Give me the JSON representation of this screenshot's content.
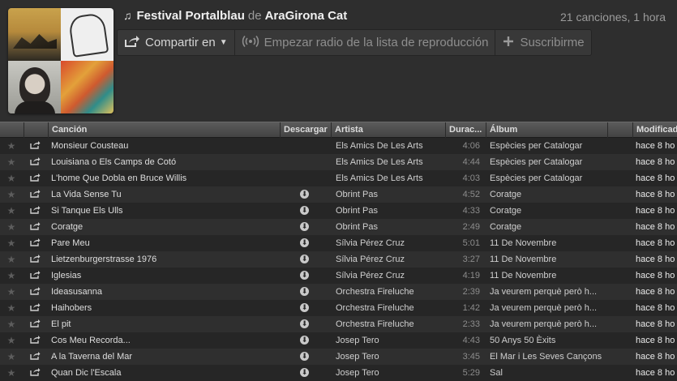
{
  "header": {
    "note_icon": "♫",
    "playlist_name": "Festival Portalblau",
    "by_label": "de",
    "owner": "AraGirona Cat",
    "summary": "21 canciones, 1 hora"
  },
  "toolbar": {
    "share_label": "Compartir en",
    "radio_label": "Empezar radio de la lista de reproducción",
    "subscribe_label": "Suscribirme"
  },
  "columns": {
    "song": "Canción",
    "download": "Descargar",
    "artist": "Artista",
    "duration": "Durac...",
    "album": "Álbum",
    "modified": "Modificad"
  },
  "icons": {
    "star": "★",
    "share": "↗",
    "download": "⬇"
  },
  "tracks": [
    {
      "song": "Monsieur Cousteau",
      "downloadable": false,
      "artist": "Els Amics De Les Arts",
      "duration": "4:06",
      "album": "Espècies per Catalogar",
      "modified": "hace 8 ho"
    },
    {
      "song": "Louisiana o Els Camps de Cotó",
      "downloadable": false,
      "artist": "Els Amics De Les Arts",
      "duration": "4:44",
      "album": "Espècies per Catalogar",
      "modified": "hace 8 ho"
    },
    {
      "song": "L'home Que Dobla en Bruce Willis",
      "downloadable": false,
      "artist": "Els Amics De Les Arts",
      "duration": "4:03",
      "album": "Espècies per Catalogar",
      "modified": "hace 8 ho"
    },
    {
      "song": "La Vida Sense Tu",
      "downloadable": true,
      "artist": "Obrint Pas",
      "duration": "4:52",
      "album": "Coratge",
      "modified": "hace 8 ho"
    },
    {
      "song": "Si Tanque Els Ulls",
      "downloadable": true,
      "artist": "Obrint Pas",
      "duration": "4:33",
      "album": "Coratge",
      "modified": "hace 8 ho"
    },
    {
      "song": "Coratge",
      "downloadable": true,
      "artist": "Obrint Pas",
      "duration": "2:49",
      "album": "Coratge",
      "modified": "hace 8 ho"
    },
    {
      "song": "Pare Meu",
      "downloadable": true,
      "artist": "Sílvia Pérez Cruz",
      "duration": "5:01",
      "album": "11 De Novembre",
      "modified": "hace 8 ho"
    },
    {
      "song": "Lietzenburgerstrasse 1976",
      "downloadable": true,
      "artist": "Sílvia Pérez Cruz",
      "duration": "3:27",
      "album": "11 De Novembre",
      "modified": "hace 8 ho"
    },
    {
      "song": "Iglesias",
      "downloadable": true,
      "artist": "Sílvia Pérez Cruz",
      "duration": "4:19",
      "album": "11 De Novembre",
      "modified": "hace 8 ho"
    },
    {
      "song": "Ideasusanna",
      "downloadable": true,
      "artist": "Orchestra Fireluche",
      "duration": "2:39",
      "album": "Ja veurem perquè però h...",
      "modified": "hace 8 ho"
    },
    {
      "song": "Haihobers",
      "downloadable": true,
      "artist": "Orchestra Fireluche",
      "duration": "1:42",
      "album": "Ja veurem perquè però h...",
      "modified": "hace 8 ho"
    },
    {
      "song": "El pit",
      "downloadable": true,
      "artist": "Orchestra Fireluche",
      "duration": "2:33",
      "album": "Ja veurem perquè però h...",
      "modified": "hace 8 ho"
    },
    {
      "song": "Cos Meu Recorda...",
      "downloadable": true,
      "artist": "Josep Tero",
      "duration": "4:43",
      "album": "50 Anys 50 Èxits",
      "modified": "hace 8 ho"
    },
    {
      "song": "A la Taverna del Mar",
      "downloadable": true,
      "artist": "Josep Tero",
      "duration": "3:45",
      "album": "El Mar i Les Seves Cançons",
      "modified": "hace 8 ho"
    },
    {
      "song": "Quan Dic l'Escala",
      "downloadable": true,
      "artist": "Josep Tero",
      "duration": "5:29",
      "album": "Sal",
      "modified": "hace 8 ho"
    }
  ]
}
